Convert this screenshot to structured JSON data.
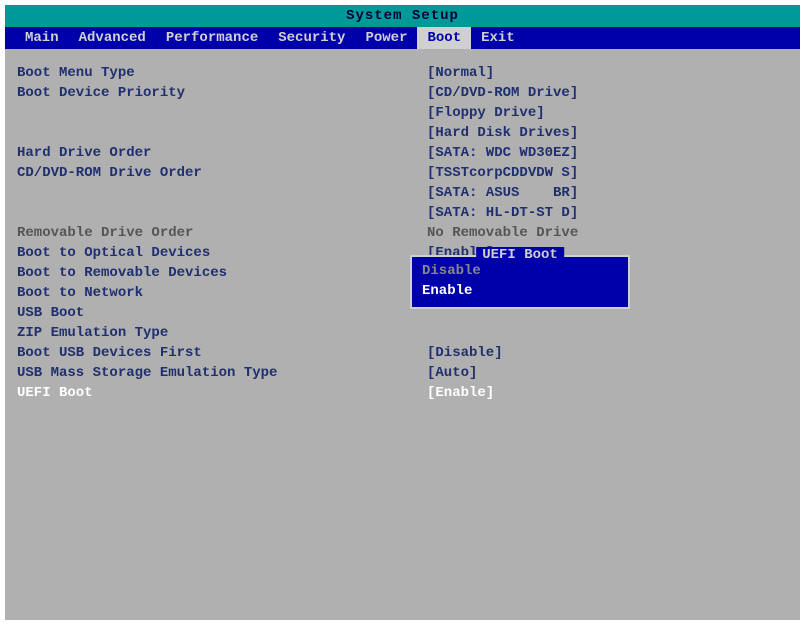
{
  "title": "System Setup",
  "menu": [
    {
      "label": "Main"
    },
    {
      "label": "Advanced"
    },
    {
      "label": "Performance"
    },
    {
      "label": "Security"
    },
    {
      "label": "Power"
    },
    {
      "label": "Boot",
      "active": true
    },
    {
      "label": "Exit"
    }
  ],
  "rows": [
    {
      "label": "Boot Menu Type",
      "value": "[Normal]"
    },
    {
      "label": "Boot Device Priority",
      "value": "[CD/DVD-ROM Drive]"
    },
    {
      "label": "",
      "value": "[Floppy Drive]"
    },
    {
      "label": "",
      "value": "[Hard Disk Drives]"
    },
    {
      "label": "Hard Drive Order",
      "value": "[SATA: WDC WD30EZ]"
    },
    {
      "label": "CD/DVD-ROM Drive Order",
      "value": "[TSSTcorpCDDVDW S]"
    },
    {
      "label": "",
      "value": "[SATA: ASUS    BR]"
    },
    {
      "label": "",
      "value": "[SATA: HL-DT-ST D]"
    },
    {
      "label": "Removable Drive Order",
      "value": "No Removable Drive",
      "disabled": true
    },
    {
      "label": "Boot to Optical Devices",
      "value": "[Enable]"
    },
    {
      "label": "Boot to Removable Devices",
      "value": ""
    },
    {
      "label": "Boot to Network",
      "value": ""
    },
    {
      "label": "USB Boot",
      "value": ""
    },
    {
      "label": "ZIP Emulation Type",
      "value": ""
    },
    {
      "label": "Boot USB Devices First",
      "value": "[Disable]"
    },
    {
      "label": "USB Mass Storage Emulation Type",
      "value": "[Auto]"
    },
    {
      "label": "UEFI Boot",
      "value": "[Enable]",
      "highlighted": true
    }
  ],
  "popup": {
    "title": "UEFI Boot",
    "options": [
      {
        "label": "Disable"
      },
      {
        "label": "Enable",
        "selected": true
      }
    ]
  }
}
